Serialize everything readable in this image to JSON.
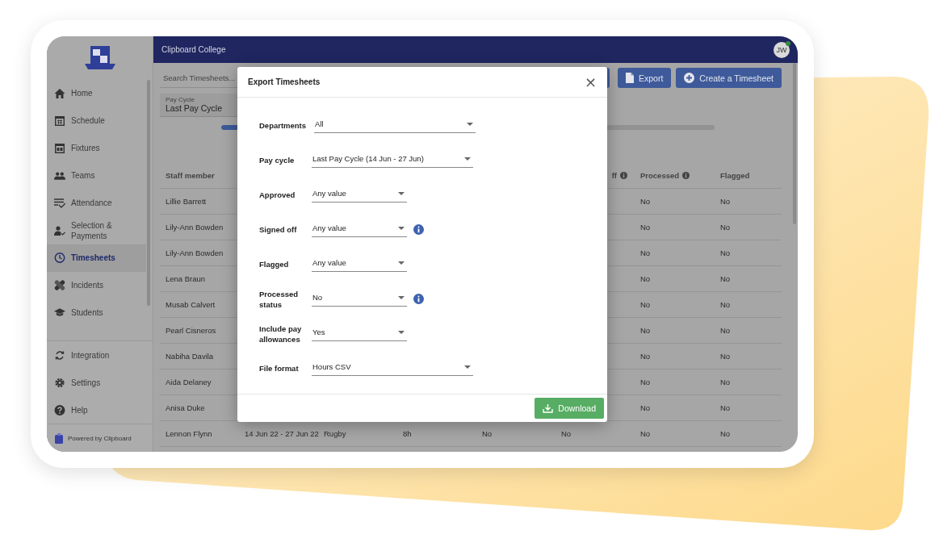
{
  "app": {
    "title": "Clipboard College",
    "avatar": "JW",
    "online": true
  },
  "sidebar": {
    "items": [
      {
        "label": "Home",
        "selected": false
      },
      {
        "label": "Schedule",
        "selected": false
      },
      {
        "label": "Fixtures",
        "selected": false
      },
      {
        "label": "Teams",
        "selected": false
      },
      {
        "label": "Attendance",
        "selected": false
      },
      {
        "label": "Selection & Payments",
        "selected": false
      },
      {
        "label": "Timesheets",
        "selected": true
      },
      {
        "label": "Incidents",
        "selected": false
      },
      {
        "label": "Students",
        "selected": false
      }
    ],
    "bottom_items": [
      {
        "label": "Integration"
      },
      {
        "label": "Settings"
      },
      {
        "label": "Help"
      }
    ],
    "footer": "Powered by Clipboard"
  },
  "toolbar": {
    "search": {
      "placeholder": "Search Timesheets..."
    },
    "pay_cycle": {
      "label": "Pay Cycle",
      "value": "Last Pay Cycle"
    },
    "buttons": [
      {
        "label": "Export"
      },
      {
        "label": "Create a Timesheet"
      }
    ],
    "progress": {
      "level": 0.3
    }
  },
  "table": {
    "columns": [
      {
        "label": "Staff member",
        "info": false
      },
      {
        "label": "ff",
        "info": true
      },
      {
        "label": "Processed",
        "info": true
      },
      {
        "label": "Flagged",
        "info": false
      }
    ],
    "rows": [
      {
        "staff_member": "Lillie Barrett",
        "processed": "No",
        "flagged": "No"
      },
      {
        "staff_member": "Lily-Ann Bowden",
        "processed": "No",
        "flagged": "No"
      },
      {
        "staff_member": "Lily-Ann Bowden",
        "processed": "No",
        "flagged": "No"
      },
      {
        "staff_member": "Lena Braun",
        "processed": "No",
        "flagged": "No"
      },
      {
        "staff_member": "Musab Calvert",
        "processed": "No",
        "flagged": "No"
      },
      {
        "staff_member": "Pearl Cisneros",
        "processed": "No",
        "flagged": "No"
      },
      {
        "staff_member": "Nabiha Davila",
        "processed": "No",
        "flagged": "No"
      },
      {
        "staff_member": "Aida Delaney",
        "processed": "No",
        "flagged": "No"
      },
      {
        "staff_member": "Anisa Duke",
        "processed": "No",
        "flagged": "No"
      },
      {
        "staff_member": "Lennon Flynn",
        "pay_cycle": "14 Jun 22 - 27 Jun 22",
        "team": "Rugby",
        "hours": "8h",
        "column_5": "No",
        "signed_off": "No",
        "processed": "No",
        "flagged": "No"
      }
    ]
  },
  "dialog": {
    "title": "Export Timesheets",
    "close": "×",
    "fields": [
      {
        "label": "Departments",
        "value": "All",
        "kind": "long",
        "info": false
      },
      {
        "label": "Pay cycle",
        "value": "Last Pay Cycle (14 Jun - 27 Jun)",
        "kind": "long",
        "info": false
      },
      {
        "label": "Approved",
        "value": "Any value",
        "kind": "short",
        "info": false
      },
      {
        "label": "Signed off",
        "value": "Any value",
        "kind": "short",
        "info": true
      },
      {
        "label": "Flagged",
        "value": "Any value",
        "kind": "short",
        "info": false
      },
      {
        "label": "Processed status",
        "value": "No",
        "kind": "short",
        "info": true
      },
      {
        "label": "Include pay allowances",
        "value": "Yes",
        "kind": "short",
        "info": false
      },
      {
        "label": "File format",
        "value": "Hours CSV",
        "kind": "long",
        "info": false
      }
    ],
    "button": "Download"
  }
}
